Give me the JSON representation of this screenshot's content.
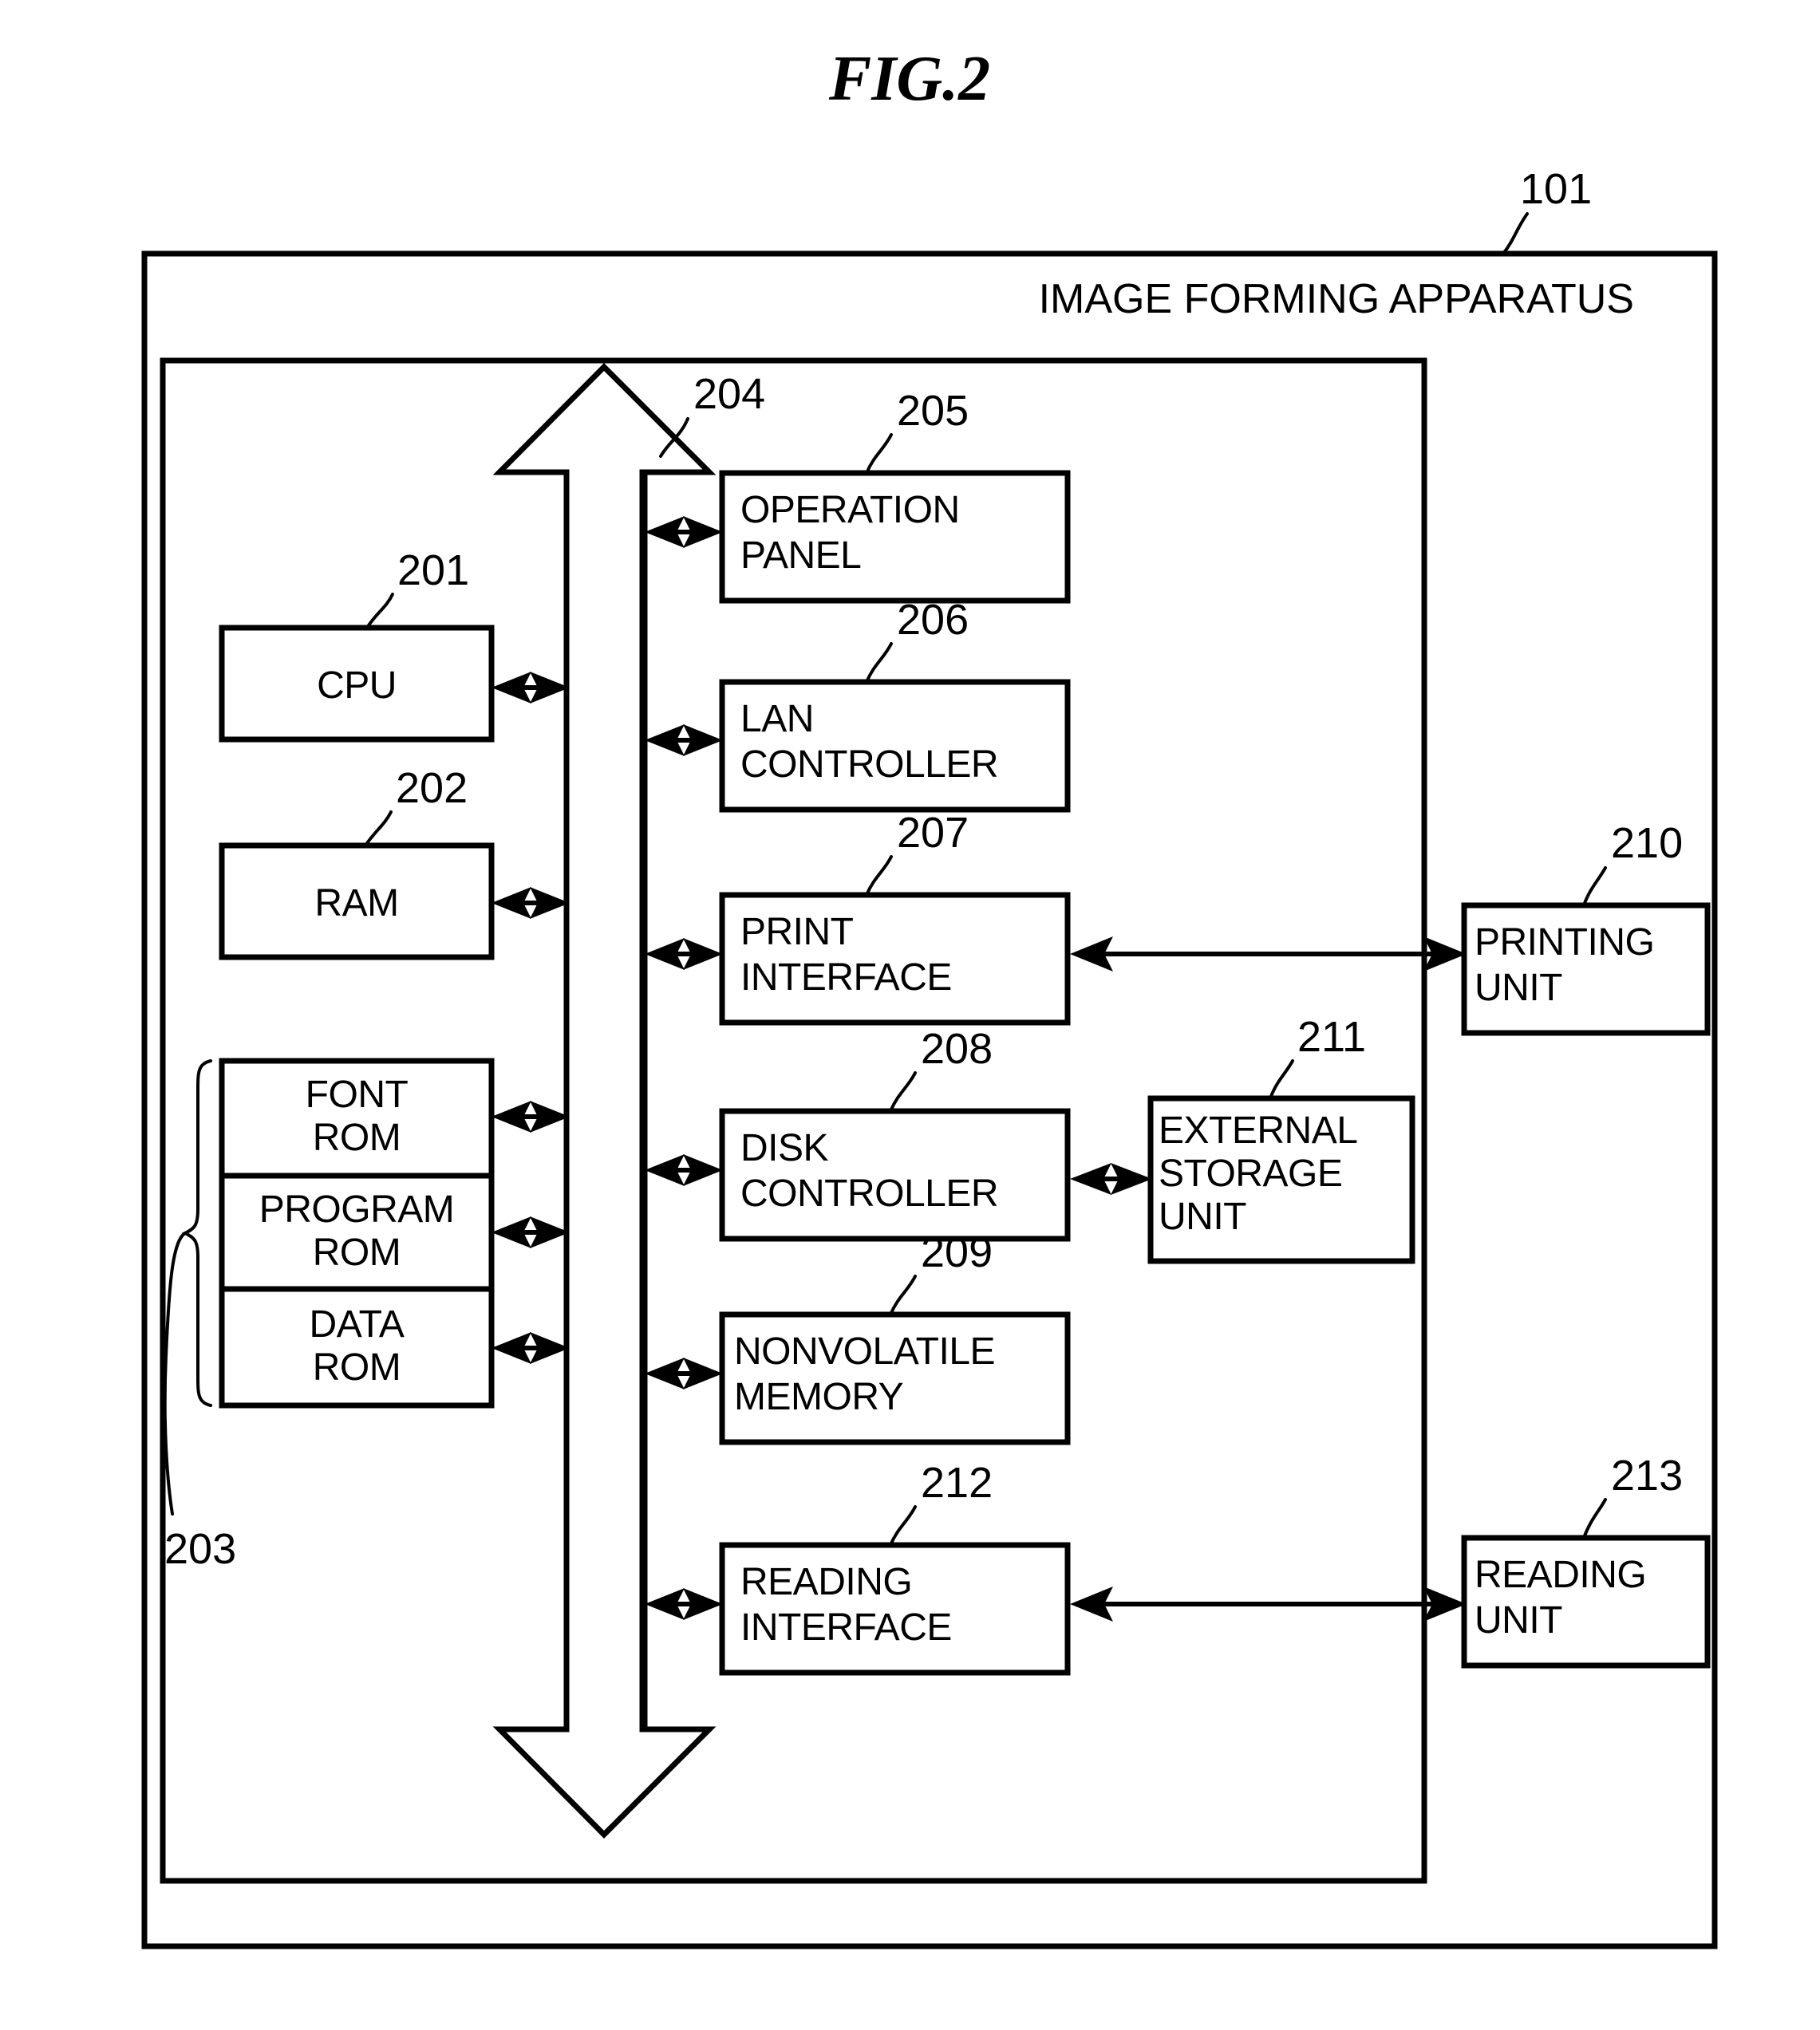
{
  "figure": {
    "title": "FIG.2",
    "apparatus_label": "IMAGE FORMING APPARATUS",
    "apparatus_ref": "101"
  },
  "left_column": {
    "blocks": [
      {
        "label": "CPU",
        "ref": "201"
      },
      {
        "label": "RAM",
        "ref": "202"
      }
    ],
    "rom_stack": {
      "ref": "203",
      "items": [
        {
          "line1": "FONT",
          "line2": "ROM"
        },
        {
          "line1": "PROGRAM",
          "line2": "ROM"
        },
        {
          "line1": "DATA",
          "line2": "ROM"
        }
      ]
    }
  },
  "bus": {
    "ref": "204"
  },
  "center_column": {
    "blocks": [
      {
        "line1": "OPERATION",
        "line2": "PANEL",
        "ref": "205"
      },
      {
        "line1": "LAN",
        "line2": "CONTROLLER",
        "ref": "206"
      },
      {
        "line1": "PRINT",
        "line2": "INTERFACE",
        "ref": "207"
      },
      {
        "line1": "DISK",
        "line2": "CONTROLLER",
        "ref": "208"
      },
      {
        "line1": "NONVOLATILE",
        "line2": "MEMORY",
        "ref": "209"
      },
      {
        "line1": "READING",
        "line2": "INTERFACE",
        "ref": "212"
      }
    ]
  },
  "right_column": {
    "blocks": [
      {
        "line1": "PRINTING",
        "line2": "UNIT",
        "line3": "",
        "ref": "210"
      },
      {
        "line1": "READING",
        "line2": "UNIT",
        "line3": "",
        "ref": "213"
      }
    ],
    "inner_blocks": [
      {
        "line1": "EXTERNAL",
        "line2": "STORAGE",
        "line3": "UNIT",
        "ref": "211"
      }
    ]
  },
  "colors": {
    "stroke": "#000000",
    "background": "#ffffff"
  }
}
